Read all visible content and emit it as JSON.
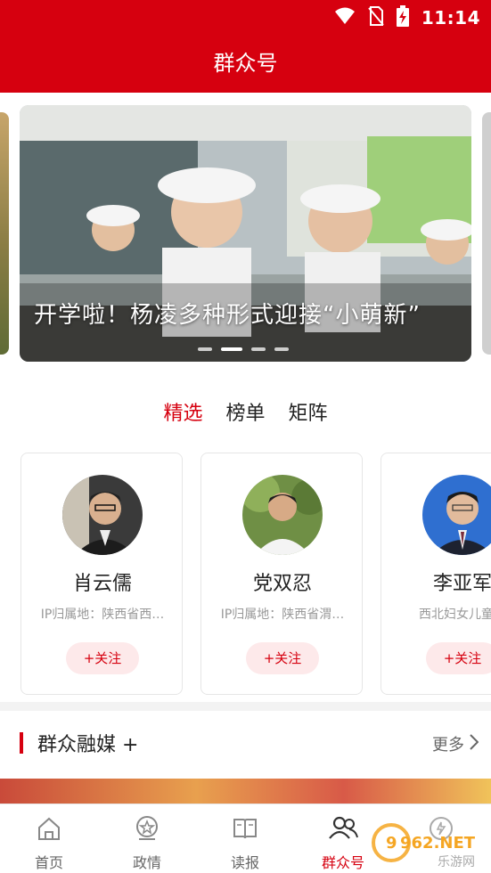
{
  "status_bar": {
    "time": "11:14"
  },
  "header": {
    "title": "群众号"
  },
  "carousel": {
    "caption": "开学啦！杨凌多种形式迎接“小萌新”",
    "slide_count": 4,
    "active_index": 1
  },
  "tabs": [
    {
      "label": "精选",
      "active": true
    },
    {
      "label": "榜单",
      "active": false
    },
    {
      "label": "矩阵",
      "active": false
    }
  ],
  "cards": [
    {
      "name": "肖云儒",
      "subtitle": "IP归属地：陕西省西…",
      "follow_label": "+关注"
    },
    {
      "name": "党双忍",
      "subtitle": "IP归属地：陕西省渭…",
      "follow_label": "+关注"
    },
    {
      "name": "李亚军",
      "subtitle": "西北妇女儿童医",
      "follow_label": "+关注"
    }
  ],
  "section": {
    "title": "群众融媒 +",
    "more_label": "更多"
  },
  "bottom_nav": [
    {
      "label": "首页",
      "icon": "home-icon",
      "active": false
    },
    {
      "label": "政情",
      "icon": "government-icon",
      "active": false
    },
    {
      "label": "读报",
      "icon": "newspaper-icon",
      "active": false
    },
    {
      "label": "群众号",
      "icon": "people-icon",
      "active": true
    },
    {
      "label": "",
      "icon": "mine-icon",
      "active": false
    }
  ],
  "watermark": {
    "line1": "962.NET",
    "line2": "乐游网"
  },
  "colors": {
    "brand_red": "#d6000f",
    "follow_bg": "#fde9ea"
  }
}
